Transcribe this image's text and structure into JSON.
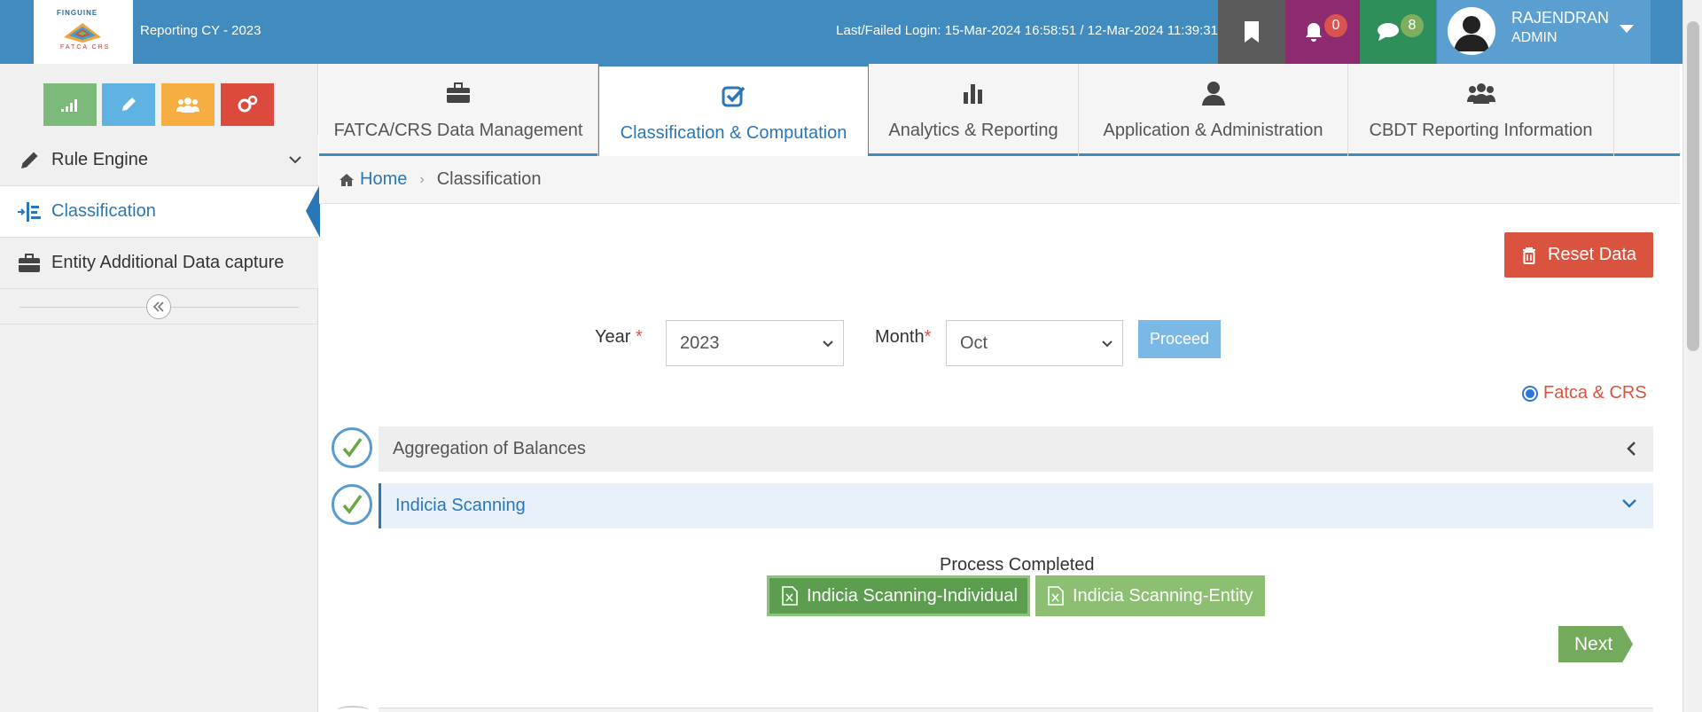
{
  "header": {
    "logo_text": "FINGUINE",
    "logo_sub": "FATCA CRS",
    "reporting": "Reporting CY - 2023",
    "last_login": "Last/Failed Login: 15-Mar-2024 16:58:51 / 12-Mar-2024 11:39:31",
    "notifications_count": "0",
    "messages_count": "8",
    "user_name": "RAJENDRAN",
    "user_role": "ADMIN"
  },
  "sidebar": {
    "quick_icons": [
      "signal-icon",
      "pencil-icon",
      "users-icon",
      "cogs-icon"
    ],
    "items": [
      {
        "label": "Rule Engine",
        "icon": "pencil-icon"
      },
      {
        "label": "Classification",
        "icon": "classification-icon"
      },
      {
        "label": "Entity Additional Data capture",
        "icon": "briefcase-icon"
      }
    ]
  },
  "tabs": [
    {
      "label": "FATCA/CRS Data Management",
      "icon": "briefcase-icon"
    },
    {
      "label": "Classification & Computation",
      "icon": "check-square-icon"
    },
    {
      "label": "Analytics & Reporting",
      "icon": "bar-chart-icon"
    },
    {
      "label": "Application & Administration",
      "icon": "user-icon"
    },
    {
      "label": "CBDT Reporting Information",
      "icon": "users-icon"
    }
  ],
  "breadcrumb": {
    "home": "Home",
    "current": "Classification"
  },
  "main": {
    "reset_label": "Reset Data",
    "year_label": "Year",
    "year_value": "2023",
    "month_label": "Month",
    "month_value": "Oct",
    "required_mark": "*",
    "proceed_label": "Proceed",
    "radio_label": "Fatca & CRS",
    "panels": [
      {
        "label": "Aggregation of Balances"
      },
      {
        "label": "Indicia Scanning"
      }
    ],
    "process_status": "Process Completed",
    "download_individual": "Indicia Scanning-Individual",
    "download_entity": "Indicia Scanning-Entity",
    "next_label": "Next"
  },
  "colors": {
    "header_bg": "#428bbe",
    "accent": "#2a77b8",
    "reset": "#d9533f",
    "success": "#5c9d4f"
  }
}
